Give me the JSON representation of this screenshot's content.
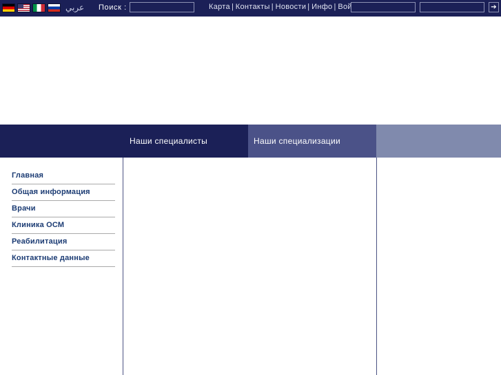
{
  "topbar": {
    "languages": [
      {
        "name": "flag-de-icon",
        "label": "Deutsch",
        "code": "de"
      },
      {
        "name": "flag-us-icon",
        "label": "English",
        "code": "us"
      },
      {
        "name": "flag-it-icon",
        "label": "Italiano",
        "code": "it"
      },
      {
        "name": "flag-ru-icon",
        "label": "Русский",
        "code": "ru"
      }
    ],
    "arabic_link": "عربي",
    "search_label": "Поиск :",
    "search_value": "",
    "search_placeholder": "",
    "nav": [
      {
        "label": "Карта"
      },
      {
        "label": "Контакты"
      },
      {
        "label": "Новости"
      },
      {
        "label": "Инфо"
      },
      {
        "label": "Войти"
      }
    ],
    "nav_separator": "|",
    "login": {
      "user_value": "",
      "user_placeholder": "",
      "pass_value": "",
      "pass_placeholder": "",
      "submit_label": "➔"
    }
  },
  "tabs": [
    {
      "label": "Наши специалисты",
      "active": true
    },
    {
      "label": "Наши специализации",
      "active": false
    },
    {
      "label": "",
      "active": false
    }
  ],
  "sidebar": {
    "items": [
      {
        "label": "Главная"
      },
      {
        "label": "Общая информация"
      },
      {
        "label": "Врачи"
      },
      {
        "label": "Клиника ОСМ"
      },
      {
        "label": "Реабилитация"
      },
      {
        "label": "Контактные данные"
      }
    ]
  },
  "colors": {
    "topbar_bg": "#1b2057",
    "tab_active_bg": "#1b2057",
    "tab_inactive_bg": "#4b5288",
    "tab_filler_bg": "#808aad",
    "link_text": "#1b3b73",
    "border": "#4a5182",
    "divider": "#a9a9a9"
  }
}
